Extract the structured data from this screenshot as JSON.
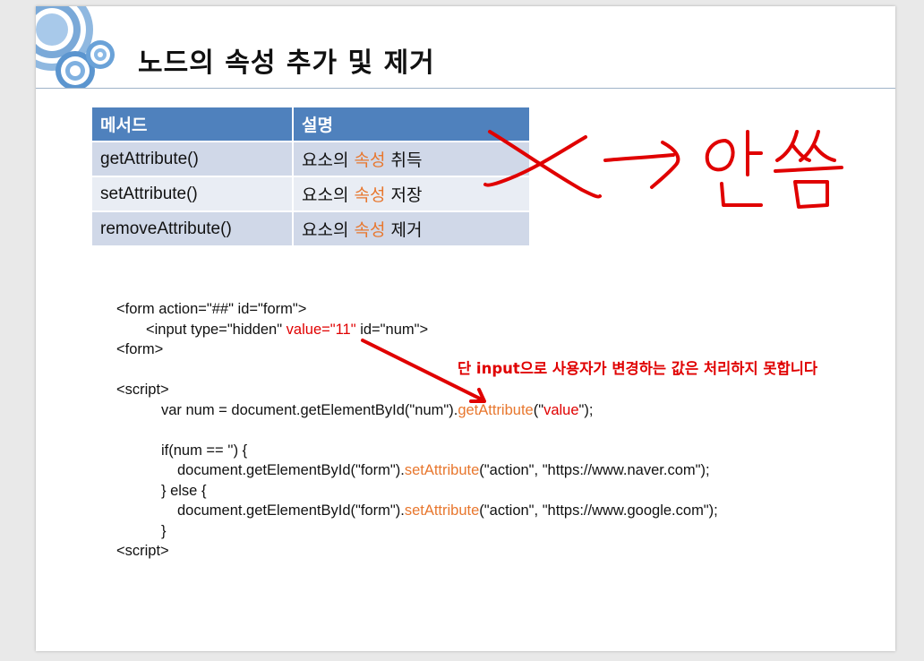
{
  "slide": {
    "title": "노드의 속성 추가 및 제거",
    "table": {
      "headers": [
        "메서드",
        "설명"
      ],
      "rows": [
        {
          "method": "getAttribute()",
          "desc_pre": "요소의 ",
          "desc_accent": "속성",
          "desc_post": " 취득"
        },
        {
          "method": "setAttribute()",
          "desc_pre": "요소의 ",
          "desc_accent": "속성",
          "desc_post": " 저장"
        },
        {
          "method": "removeAttribute()",
          "desc_pre": "요소의 ",
          "desc_accent": "속성",
          "desc_post": " 제거"
        }
      ]
    },
    "code": {
      "l1": "<form action=\"##\" id=\"form\">",
      "l2_a": "<input type=\"hidden\" ",
      "l2_red": "value=\"11\"",
      "l2_b": " id=\"num\">",
      "l3": "<form>",
      "l4": "<script>",
      "l5_a": "var num = document.getElementById(\"num\").",
      "l5_orange": "getAttribute",
      "l5_b": "(\"",
      "l5_red": "value",
      "l5_c": "\");",
      "l6": "if(num == '') {",
      "l7_a": "document.getElementById(\"form\").",
      "l7_orange": "setAttribute",
      "l7_b": "(\"action\", \"https://www.naver.com\");",
      "l8": "} else {",
      "l9_a": "document.getElementById(\"form\").",
      "l9_orange": "setAttribute",
      "l9_b": "(\"action\", \"https://www.google.com\");",
      "l10": "}",
      "l11": "<script>"
    },
    "annotation_note": "단 input으로 사용자가 변경하는 값은 처리하지 못합니다",
    "handwriting_text": "X → 안씀"
  },
  "colors": {
    "header_blue": "#4f81bd",
    "row_dark": "#d0d8e8",
    "row_light": "#e9edf4",
    "accent_orange": "#e8772e",
    "annotation_red": "#e00000"
  }
}
